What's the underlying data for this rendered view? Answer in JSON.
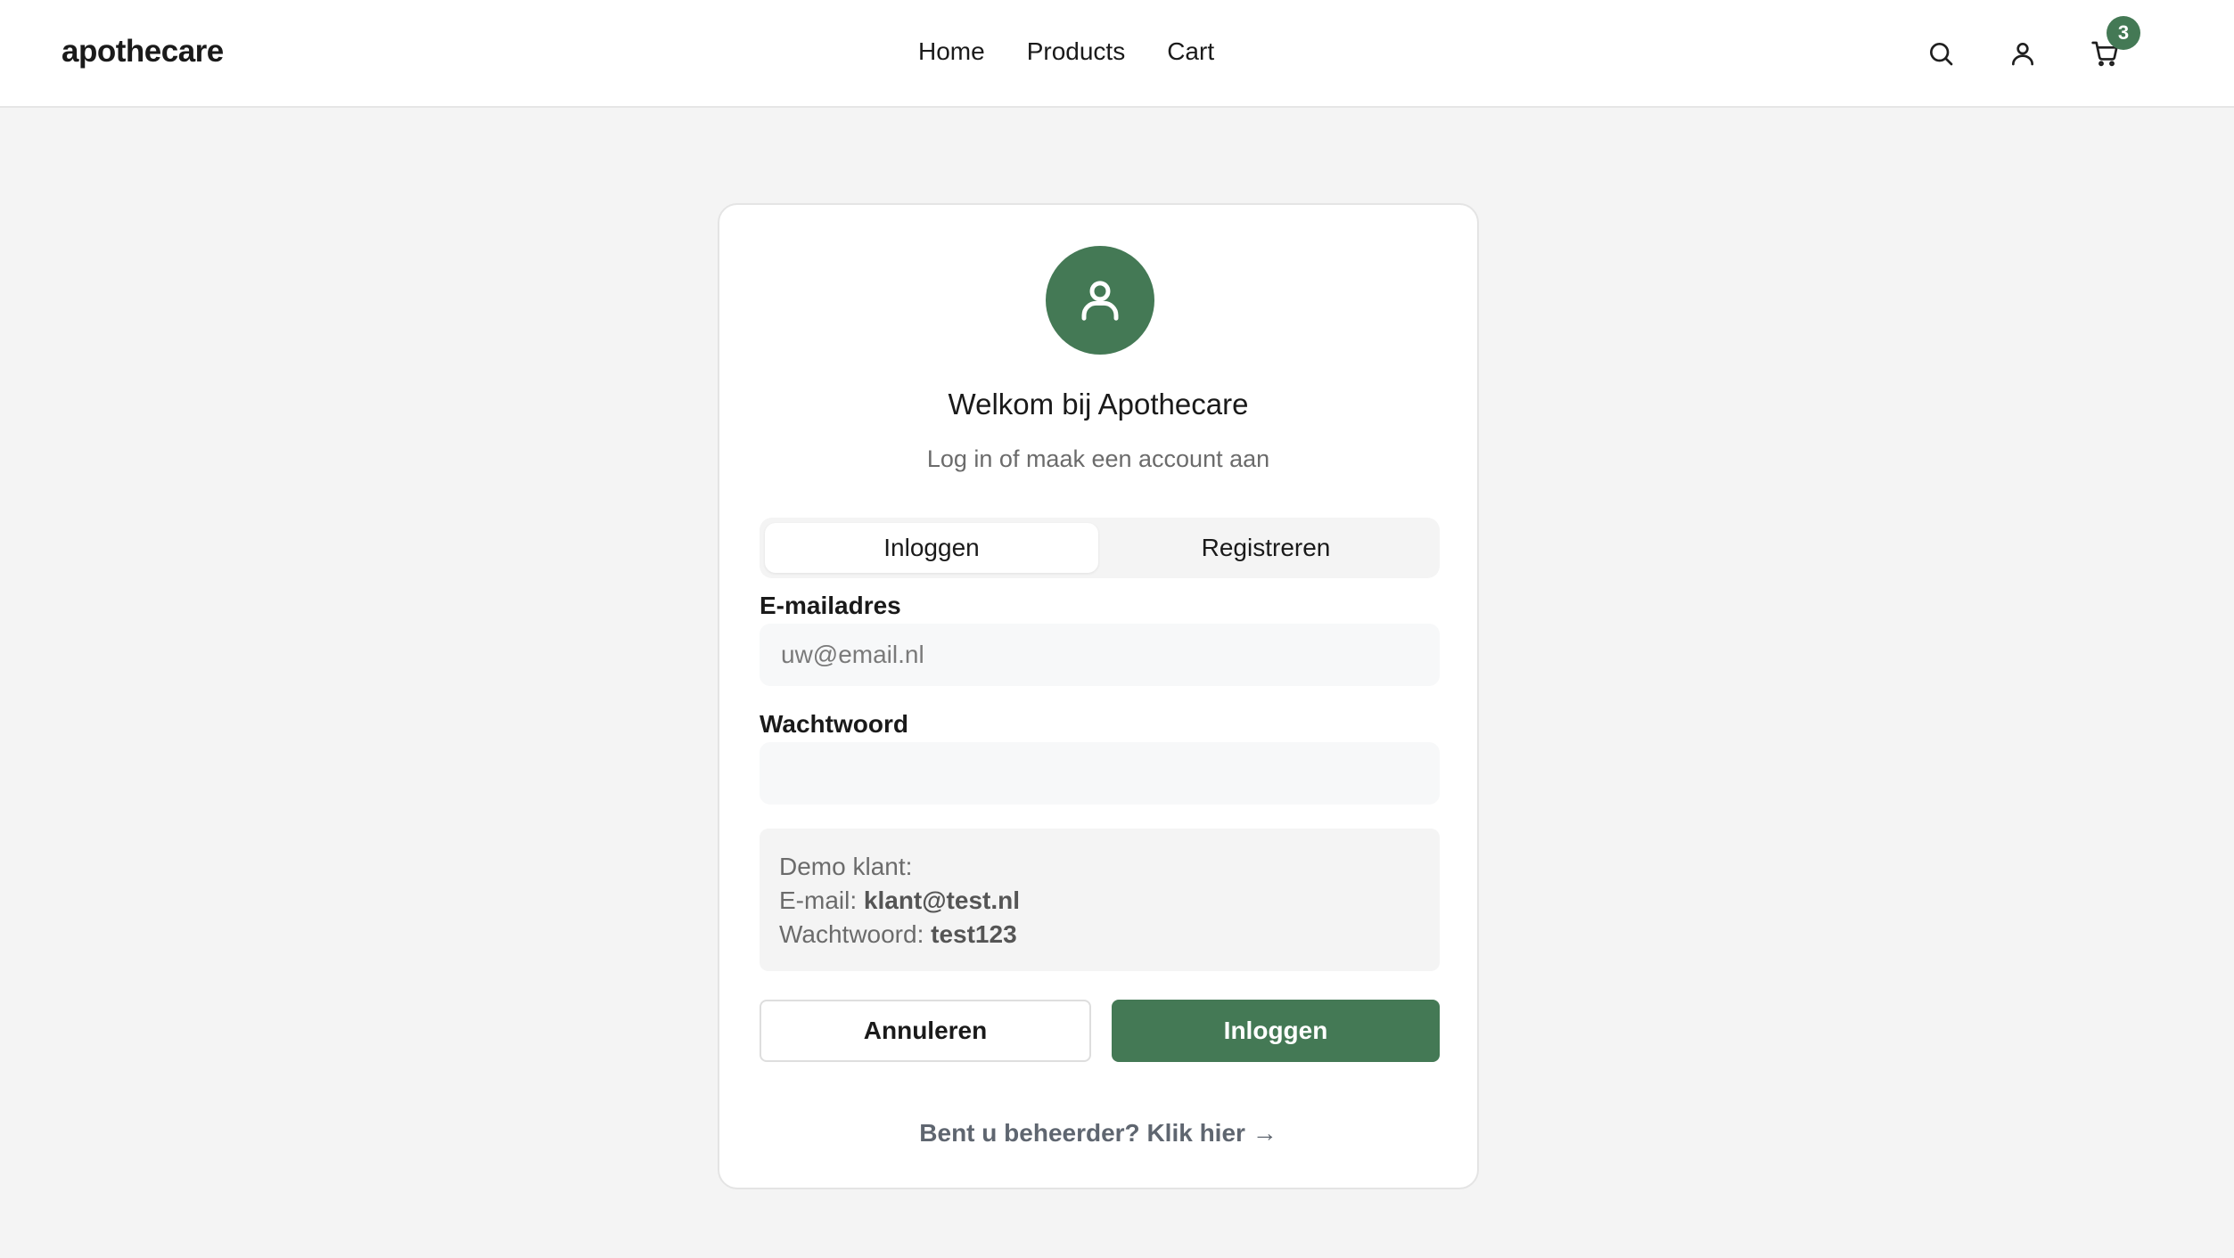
{
  "header": {
    "brand": "apothecare",
    "nav": [
      "Home",
      "Products",
      "Cart"
    ],
    "cart_count": "3",
    "icons": [
      "search-icon",
      "user-icon",
      "cart-icon"
    ]
  },
  "login": {
    "welcome": "Welkom bij Apothecare",
    "subtitle": "Log in of maak een account aan",
    "tabs": [
      "Inloggen",
      "Registreren"
    ],
    "email_label": "E-mailadres",
    "email_placeholder": "uw@email.nl",
    "email_value": "",
    "password_label": "Wachtwoord",
    "password_value": "",
    "demo": {
      "title": "Demo klant:",
      "email_prefix": "E-mail:",
      "email": "klant@test.nl",
      "password_prefix": "Wachtwoord:",
      "password": "test123"
    },
    "cancel_label": "Annuleren",
    "submit_label": "Inloggen",
    "admin_link": "Bent u beheerder? Klik hier →"
  },
  "colors": {
    "accent": "#447955",
    "background": "#f4f4f4"
  }
}
